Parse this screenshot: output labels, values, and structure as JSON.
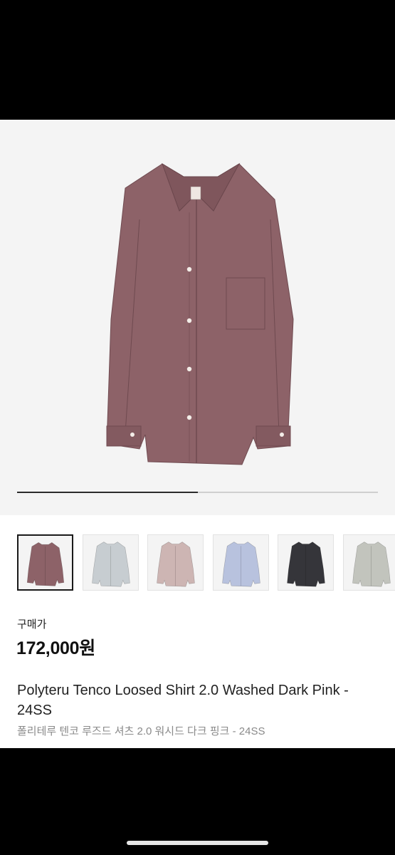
{
  "product": {
    "price_label": "구매가",
    "price": "172,000원",
    "title": "Polyteru Tenco Loosed Shirt 2.0 Washed Dark Pink - 24SS",
    "subtitle": "폴리테루 텐코 루즈드 셔츠 2.0 워시드 다크 핑크 - 24SS"
  },
  "gallery": {
    "progress": 0.5,
    "main_color": "#8d6268",
    "thumbnails": [
      {
        "color": "#8d6268",
        "selected": true
      },
      {
        "color": "#c7cdd1",
        "selected": false
      },
      {
        "color": "#cdb5b3",
        "selected": false
      },
      {
        "color": "#b8c2de",
        "selected": false
      },
      {
        "color": "#35353a",
        "selected": false
      },
      {
        "color": "#c2c4bd",
        "selected": false
      }
    ]
  },
  "colors": {
    "background": "#ffffff",
    "text_primary": "#111111",
    "text_secondary": "#8a8a8a"
  }
}
